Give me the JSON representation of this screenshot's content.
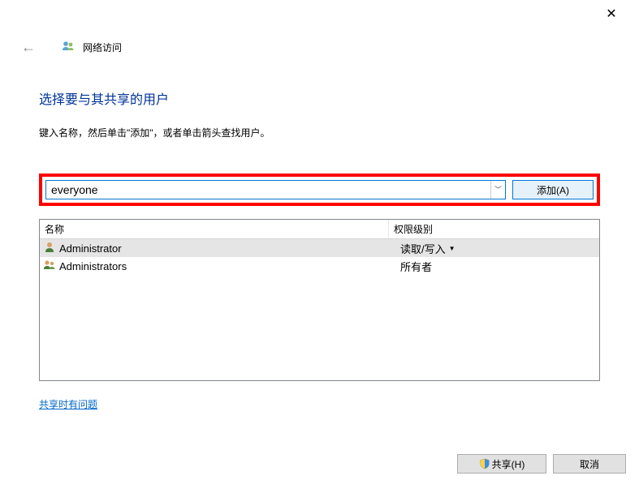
{
  "window": {
    "title": "网络访问"
  },
  "heading": "选择要与其共享的用户",
  "instruction": "键入名称，然后单击\"添加\"，或者单击箭头查找用户。",
  "input": {
    "value": "everyone",
    "add_label": "添加(A)"
  },
  "table": {
    "col_name": "名称",
    "col_perm": "权限级别",
    "rows": [
      {
        "name": "Administrator",
        "perm": "读取/写入",
        "dropdown": true,
        "selected": true,
        "icon": "single"
      },
      {
        "name": "Administrators",
        "perm": "所有者",
        "dropdown": false,
        "selected": false,
        "icon": "group"
      }
    ]
  },
  "trouble_link": "共享时有问题",
  "footer": {
    "share": "共享(H)",
    "cancel": "取消"
  }
}
